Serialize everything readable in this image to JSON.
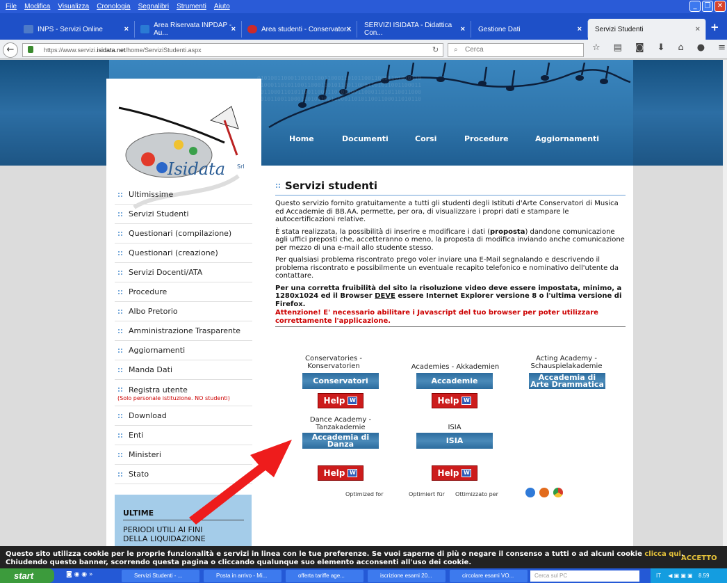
{
  "menu": [
    "File",
    "Modifica",
    "Visualizza",
    "Cronologia",
    "Segnalibri",
    "Strumenti",
    "Aiuto"
  ],
  "tabs": [
    {
      "label": "INPS - Servizi Online",
      "icon": "inps-icon",
      "color": "#4d7ac8"
    },
    {
      "label": "Area Riservata INPDAP - Au...",
      "icon": "inpdap-icon",
      "color": "#2a7ad4"
    },
    {
      "label": "Area studenti - Conservator...",
      "icon": "conservatorio-icon",
      "color": "#cc2a2a"
    },
    {
      "label": "SERVIZI ISIDATA - Didattica Con...",
      "icon": "isidata-icon",
      "color": "#d0d0d0"
    },
    {
      "label": "Gestione Dati",
      "icon": "",
      "color": ""
    },
    {
      "label": "Servizi Studenti",
      "icon": "",
      "color": ""
    }
  ],
  "browser": {
    "url_prefix": "https://www.servizi.",
    "url_domain": "isidata.net",
    "url_path": "/home/ServiziStudenti.aspx",
    "search_placeholder": "Cerca",
    "new_tab": "+"
  },
  "site": {
    "logo_text": "Isidata",
    "logo_suffix": "Srl",
    "topnav": [
      "Home",
      "Documenti",
      "Corsi",
      "Procedure",
      "Aggiornamenti"
    ]
  },
  "sidebar": {
    "items": [
      "Ultimissime",
      "Servizi Studenti",
      "Questionari (compilazione)",
      "Questionari (creazione)",
      "Servizi Docenti/ATA",
      "Procedure",
      "Albo Pretorio",
      "Amministrazione Trasparente",
      "Aggiornamenti",
      "Manda Dati",
      "Registra utente"
    ],
    "registra_note": "(Solo personale istituzione. NO studenti)",
    "items2": [
      "Download",
      "Enti",
      "Ministeri",
      "Stato"
    ],
    "ultime_title": "ULTIME",
    "ultime_text1": "PERIODI UTILI AI FINI",
    "ultime_text2": "DELLA LIQUIDAZIONE"
  },
  "main": {
    "title": "Servizi studenti",
    "p1": "Questo servizio fornito gratuitamente a tutti gli studenti degli Istituti d'Arte Conservatori di Musica ed Accademie di BB.AA. permette, per ora, di visualizzare i propri dati e stampare le autocertificazioni relative.",
    "p2a": "È stata realizzata, la possibilità di inserire e modificare i dati (",
    "p2b": "proposta",
    "p2c": ") dandone comunicazione agli uffici preposti che, accetteranno o meno, la proposta di modifica inviando anche comunicazione per mezzo di una e-mail allo studente stesso.",
    "p3": "Per qualsiasi problema riscontrato prego voler inviare una E-Mail segnalando e descrivendo il problema riscontrato e possibilmente un eventuale recapito telefonico e nominativo dell'utente da contattare.",
    "p4a": "Per una corretta fruibilità del sito la risoluzione video deve essere impostata, minimo, a 1280x1024 ed il Browser ",
    "p4b": "DEVE",
    "p4c": " essere Internet Explorer versione 8 o l'ultima versione di Firefox.",
    "p5": "Attenzione! E' necessario abilitare i Javascript del tuo browser per poter utilizzare correttamente l'applicazione."
  },
  "categories": {
    "cons_label1": "Conservatories -",
    "cons_label2": "Konservatorien",
    "cons_btn": "Conservatori",
    "acc_label": "Academies - Akkademien",
    "acc_btn": "Accademie",
    "act_label1": "Acting Academy -",
    "act_label2": "Schauspielakademie",
    "act_btn1": "Accademia di",
    "act_btn2": "Arte Drammatica",
    "dance_label1": "Dance Academy -",
    "dance_label2": "Tanzakademie",
    "dance_btn1": "Accademia di",
    "dance_btn2": "Danza",
    "isia_label": "ISIA",
    "isia_btn": "ISIA",
    "help": "Help",
    "help_icon": "W"
  },
  "optimized": [
    "Optimized for",
    "Optimiert für",
    "Ottimizzato per"
  ],
  "cookie": {
    "line1a": "Questo sito utilizza cookie per le proprie funzionalità e servizi in linea con le tue preferenze. Se vuoi saperne di più o negare il consenso a tutti o ad alcuni cookie ",
    "link": "clicca qui",
    "line1b": ".",
    "line2": "Chiudendo questo banner, scorrendo questa pagina o cliccando qualunque suo elemento acconsenti all'uso dei cookie.",
    "accept": "ACCETTO"
  },
  "taskbar": {
    "start": "start",
    "buttons": [
      "Servizi Studenti - ...",
      "Posta in arrivo - Mi...",
      "offerta tariffe age...",
      "iscrizione esami 20...",
      "circolare esami VO..."
    ],
    "search_placeholder": "Cerca sul PC",
    "lang": "IT",
    "time": "8.59"
  }
}
